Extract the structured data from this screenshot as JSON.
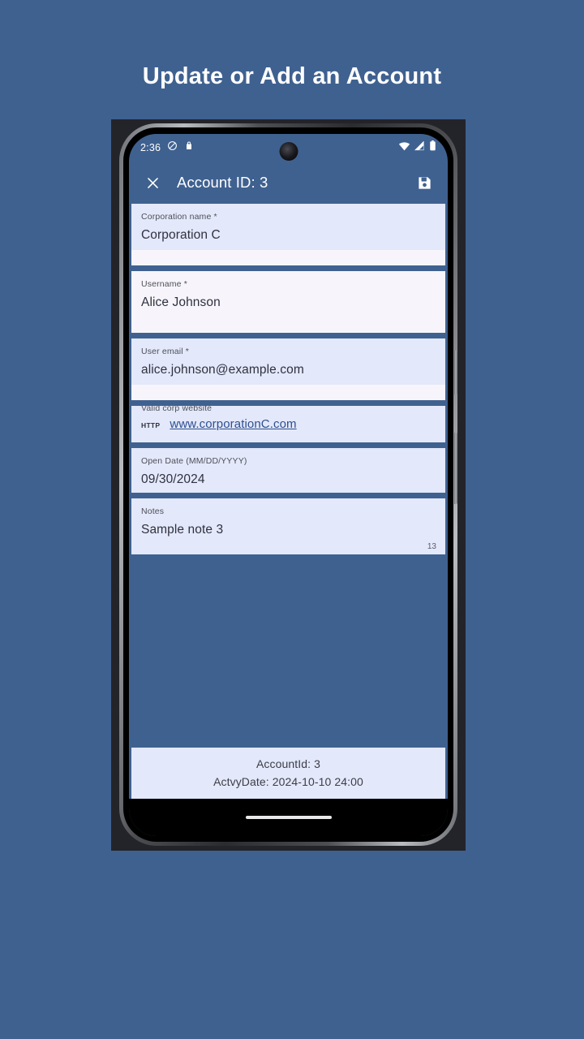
{
  "page": {
    "heading": "Update or Add an Account",
    "background_color": "#3f6190"
  },
  "status_bar": {
    "time": "2:36",
    "left_icons": [
      "do-not-disturb-icon",
      "bag-icon"
    ],
    "right_icons": [
      "wifi-icon",
      "cellular-signal-icon",
      "battery-icon"
    ]
  },
  "app_bar": {
    "close_label": "×",
    "title": "Account ID: 3",
    "save_icon": "save-floppy-icon"
  },
  "form": {
    "fields": [
      {
        "name": "corporation-name",
        "label": "Corporation name *",
        "value": "Corporation C"
      },
      {
        "name": "username",
        "label": "Username *",
        "value": "Alice Johnson"
      },
      {
        "name": "user-email",
        "label": "User email *",
        "value": "alice.johnson@example.com"
      },
      {
        "name": "corp-website",
        "label": "Valid corp website",
        "prefix": "HTTP",
        "value": "www.corporationC.com"
      },
      {
        "name": "open-date",
        "label": "Open Date (MM/DD/YYYY)",
        "value": "09/30/2024"
      },
      {
        "name": "notes",
        "label": "Notes",
        "value": "Sample note 3",
        "counter": "13"
      }
    ]
  },
  "footer": {
    "account_id": "AccountId: 3",
    "activity_date": "ActvyDate: 2024-10-10 24:00"
  },
  "colors": {
    "app_background": "#3f6190",
    "field_background": "#e3e8fa",
    "field_background_light": "#f7f5fb",
    "link": "#2e4f8f"
  }
}
